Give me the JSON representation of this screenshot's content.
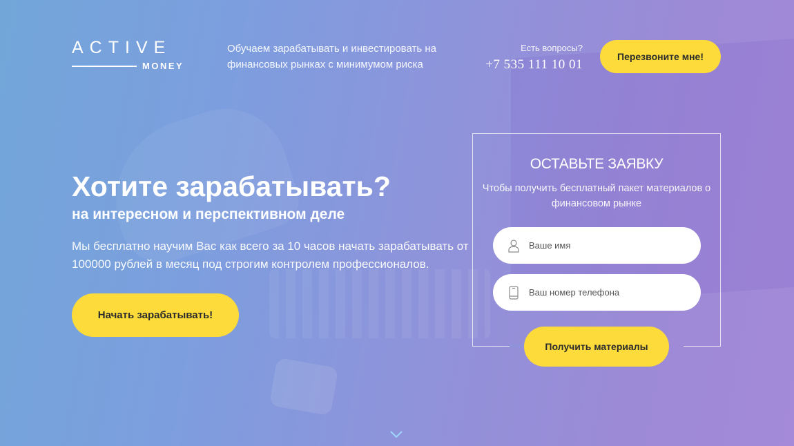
{
  "header": {
    "logo": {
      "main": "ACTIVE",
      "sub": "MONEY"
    },
    "tagline": "Обучаем зарабатывать и инвестировать на финансовых рынках с минимумом риска",
    "question": "Есть вопросы?",
    "phone": "+7 535 111 10 01",
    "callback_label": "Перезвоните мне!"
  },
  "hero": {
    "title": "Хотите зарабатывать?",
    "subtitle": "на интересном и перспективном деле",
    "text": "Мы бесплатно научим Вас как всего за 10 часов начать зарабатывать от 100000 рублей в месяц под строгим контролем профессионалов.",
    "cta_label": "Начать зарабатывать!"
  },
  "form": {
    "title": "ОСТАВЬТЕ ЗАЯВКУ",
    "description": "Чтобы получить бесплатный пакет материалов о финансовом рынке",
    "name_placeholder": "Ваше имя",
    "phone_placeholder": "Ваш номер телефона",
    "submit_label": "Получить материалы"
  },
  "icons": {
    "name_field": "user-icon",
    "phone_field": "smartphone-icon",
    "scroll": "chevron-down-icon"
  },
  "colors": {
    "accent": "#fddb3a",
    "gradient_start": "#72a6d9",
    "gradient_end": "#a48ad8"
  }
}
